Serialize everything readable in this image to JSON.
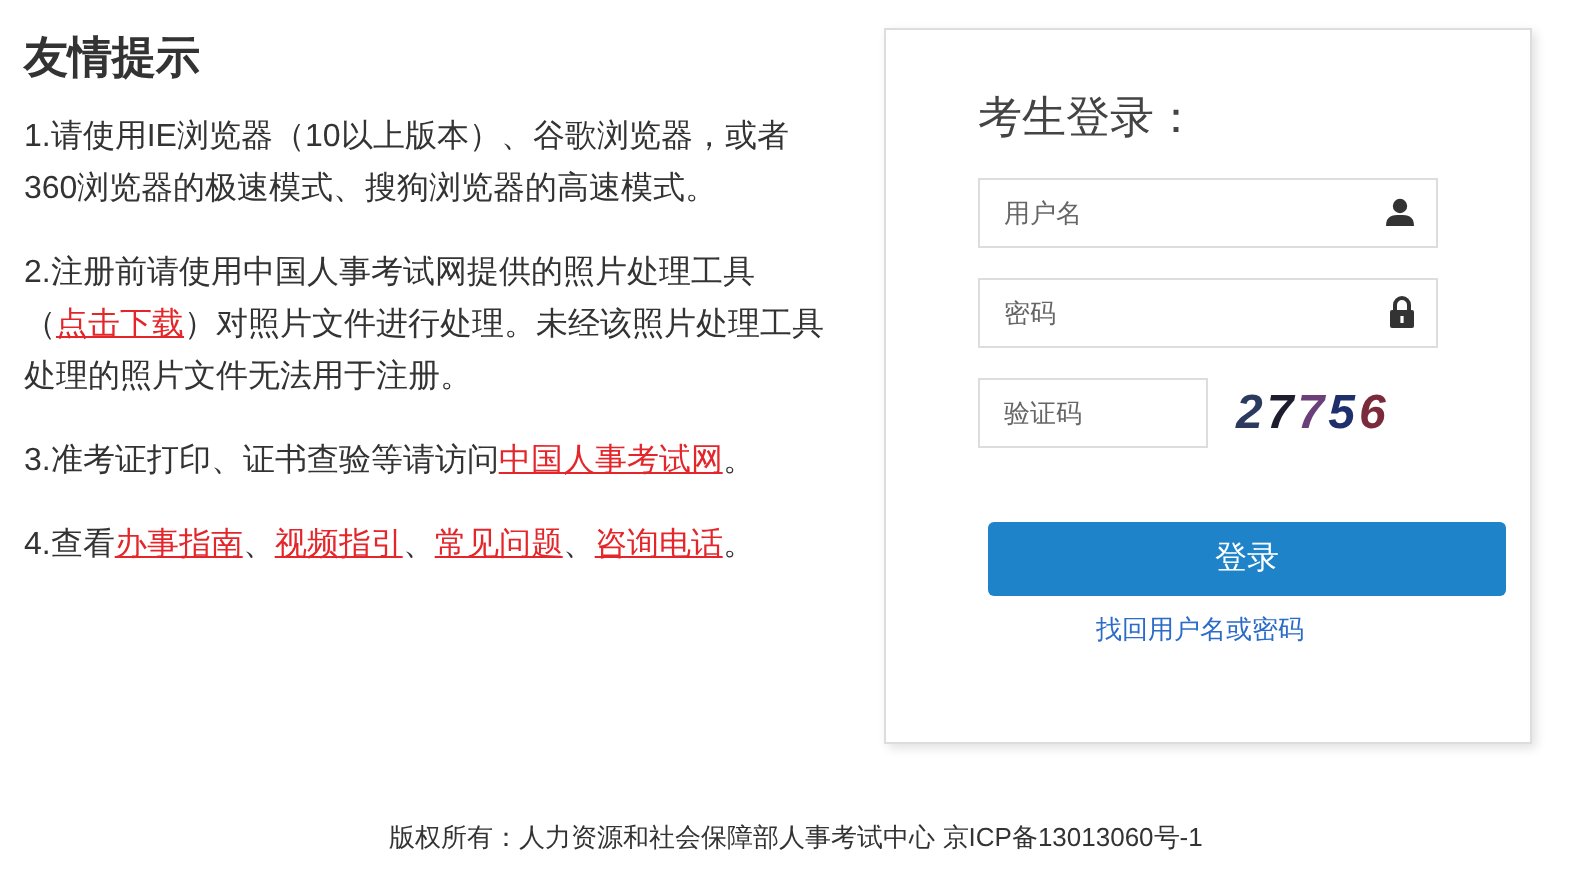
{
  "notice": {
    "title": "友情提示",
    "items": [
      {
        "parts": [
          {
            "text": "1.请使用IE浏览器（10以上版本）、谷歌浏览器，或者360浏览器的极速模式、搜狗浏览器的高速模式。",
            "link": false
          }
        ]
      },
      {
        "parts": [
          {
            "text": "2.注册前请使用中国人事考试网提供的照片处理工具（",
            "link": false
          },
          {
            "text": "点击下载",
            "link": true
          },
          {
            "text": "）对照片文件进行处理。未经该照片处理工具处理的照片文件无法用于注册。",
            "link": false
          }
        ]
      },
      {
        "parts": [
          {
            "text": "3.准考证打印、证书查验等请访问",
            "link": false
          },
          {
            "text": "中国人事考试网",
            "link": true
          },
          {
            "text": "。",
            "link": false
          }
        ]
      },
      {
        "parts": [
          {
            "text": "4.查看",
            "link": false
          },
          {
            "text": "办事指南",
            "link": true
          },
          {
            "text": "、",
            "link": false
          },
          {
            "text": "视频指引",
            "link": true
          },
          {
            "text": "、",
            "link": false
          },
          {
            "text": "常见问题",
            "link": true
          },
          {
            "text": "、",
            "link": false
          },
          {
            "text": "咨询电话",
            "link": true
          },
          {
            "text": "。",
            "link": false
          }
        ]
      }
    ]
  },
  "login": {
    "title": "考生登录：",
    "fields": [
      {
        "placeholder": "用户名",
        "kind": "user"
      },
      {
        "placeholder": "密码",
        "kind": "lock"
      },
      {
        "placeholder": "验证码",
        "kind": "captcha"
      }
    ],
    "captcha": "27756",
    "button": "登录",
    "recover_link": "找回用户名或密码"
  },
  "footer": "版权所有：人力资源和社会保障部人事考试中心 京ICP备13013060号-1"
}
